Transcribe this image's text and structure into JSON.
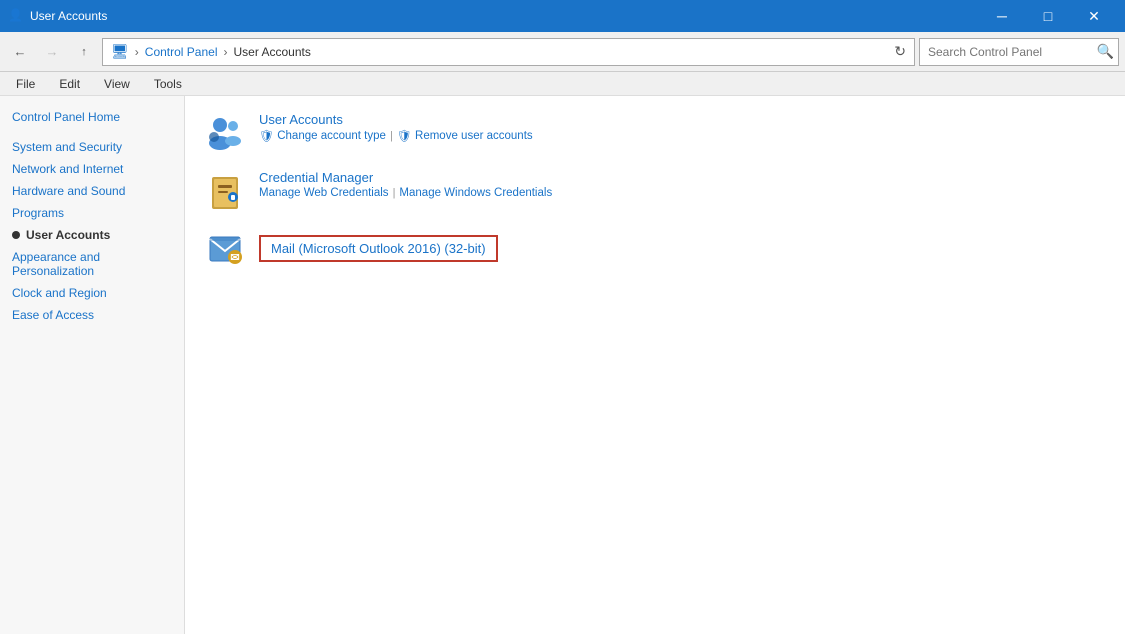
{
  "titlebar": {
    "title": "User Accounts",
    "icon": "👤",
    "btn_minimize": "─",
    "btn_maximize": "□",
    "btn_close": "✕"
  },
  "addressbar": {
    "back_title": "Back",
    "forward_title": "Forward",
    "up_title": "Up",
    "breadcrumbs": [
      "Control Panel",
      "User Accounts"
    ],
    "refresh": "⟳",
    "search_placeholder": "Search Control Panel",
    "search_icon": "🔍"
  },
  "menubar": {
    "items": [
      "File",
      "Edit",
      "View",
      "Tools"
    ]
  },
  "sidebar": {
    "items": [
      {
        "label": "Control Panel Home",
        "active": false,
        "bullet": false
      },
      {
        "label": "System and Security",
        "active": false,
        "bullet": false
      },
      {
        "label": "Network and Internet",
        "active": false,
        "bullet": false
      },
      {
        "label": "Hardware and Sound",
        "active": false,
        "bullet": false
      },
      {
        "label": "Programs",
        "active": false,
        "bullet": false
      },
      {
        "label": "User Accounts",
        "active": true,
        "bullet": true
      },
      {
        "label": "Appearance and\nPersonalization",
        "active": false,
        "bullet": false
      },
      {
        "label": "Clock and Region",
        "active": false,
        "bullet": false
      },
      {
        "label": "Ease of Access",
        "active": false,
        "bullet": false
      }
    ]
  },
  "content": {
    "items": [
      {
        "id": "user-accounts",
        "title": "User Accounts",
        "links": [
          {
            "label": "Change account type",
            "shield": true
          },
          {
            "label": "Remove user accounts",
            "shield": true
          }
        ]
      },
      {
        "id": "credential-manager",
        "title": "Credential Manager",
        "links": [
          {
            "label": "Manage Web Credentials",
            "shield": false
          },
          {
            "label": "Manage Windows Credentials",
            "shield": false
          }
        ]
      },
      {
        "id": "mail",
        "title": "Mail (Microsoft Outlook 2016) (32-bit)",
        "links": []
      }
    ]
  }
}
